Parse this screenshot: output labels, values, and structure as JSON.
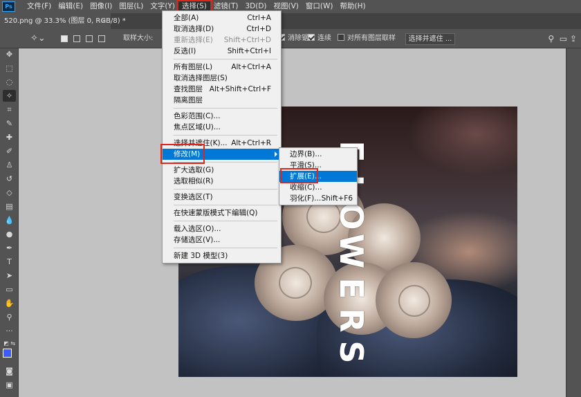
{
  "menubar": {
    "app_logo": "Ps",
    "items": [
      "文件(F)",
      "编辑(E)",
      "图像(I)",
      "图层(L)",
      "文字(Y)",
      "选择(S)",
      "滤镜(T)",
      "3D(D)",
      "视图(V)",
      "窗口(W)",
      "帮助(H)"
    ]
  },
  "document_tab": {
    "title": "520.png @ 33.3% (图层 0, RGB/8) *",
    "close": "×"
  },
  "options_bar": {
    "sample_size_label": "取样大小:",
    "anti_alias_label": "消除锯齿",
    "contiguous_label": "连续",
    "sample_all_layers_label": "对所有图层取样",
    "select_and_mask_label": "选择并遮住 ..."
  },
  "select_menu": {
    "items": [
      {
        "label": "全部(A)",
        "shortcut": "Ctrl+A",
        "disabled": false
      },
      {
        "label": "取消选择(D)",
        "shortcut": "Ctrl+D",
        "disabled": false
      },
      {
        "label": "重新选择(E)",
        "shortcut": "Shift+Ctrl+D",
        "disabled": true
      },
      {
        "label": "反选(I)",
        "shortcut": "Shift+Ctrl+I",
        "disabled": false
      },
      {
        "label": "所有图层(L)",
        "shortcut": "Alt+Ctrl+A",
        "disabled": false
      },
      {
        "label": "取消选择图层(S)",
        "shortcut": "",
        "disabled": false
      },
      {
        "label": "查找图层",
        "shortcut": "Alt+Shift+Ctrl+F",
        "disabled": false
      },
      {
        "label": "隔离图层",
        "shortcut": "",
        "disabled": false
      },
      {
        "label": "色彩范围(C)...",
        "shortcut": "",
        "disabled": false
      },
      {
        "label": "焦点区域(U)...",
        "shortcut": "",
        "disabled": false
      },
      {
        "label": "选择并遮住(K)...",
        "shortcut": "Alt+Ctrl+R",
        "disabled": false
      },
      {
        "label": "修改(M)",
        "shortcut": "",
        "disabled": false
      },
      {
        "label": "扩大选取(G)",
        "shortcut": "",
        "disabled": false
      },
      {
        "label": "选取相似(R)",
        "shortcut": "",
        "disabled": false
      },
      {
        "label": "变换选区(T)",
        "shortcut": "",
        "disabled": false
      },
      {
        "label": "在快速蒙版模式下编辑(Q)",
        "shortcut": "",
        "disabled": false
      },
      {
        "label": "载入选区(O)...",
        "shortcut": "",
        "disabled": false
      },
      {
        "label": "存储选区(V)...",
        "shortcut": "",
        "disabled": false
      },
      {
        "label": "新建 3D 模型(3)",
        "shortcut": "",
        "disabled": false
      }
    ]
  },
  "modify_submenu": {
    "items": [
      {
        "label": "边界(B)...",
        "shortcut": ""
      },
      {
        "label": "平滑(S)...",
        "shortcut": ""
      },
      {
        "label": "扩展(E)...",
        "shortcut": ""
      },
      {
        "label": "收缩(C)...",
        "shortcut": ""
      },
      {
        "label": "羽化(F)...",
        "shortcut": "Shift+F6"
      }
    ]
  },
  "canvas": {
    "text": [
      "F",
      "L",
      "O",
      "W",
      "E",
      "R",
      "S"
    ]
  },
  "colors": {
    "foreground": "#3b5bff",
    "background": "#ffffff",
    "highlight": "#0078d7",
    "annotation": "#e0261a"
  }
}
